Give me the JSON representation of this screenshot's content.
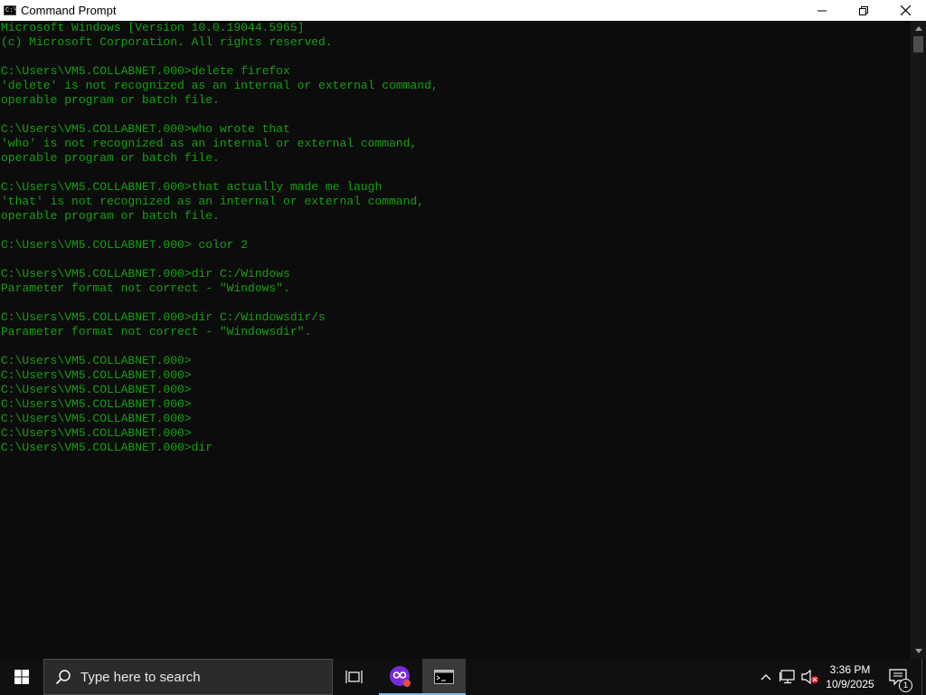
{
  "window": {
    "title": "Command Prompt",
    "icon": "cmd-icon",
    "controls": [
      "minimize-icon",
      "restore-icon",
      "close-icon"
    ]
  },
  "terminal": {
    "text_color": "#13a10e",
    "background": "#0c0c0c",
    "lines": [
      "Microsoft Windows [Version 10.0.19044.5965]",
      "(c) Microsoft Corporation. All rights reserved.",
      "",
      "C:\\Users\\VM5.COLLABNET.000>delete firefox",
      "'delete' is not recognized as an internal or external command,",
      "operable program or batch file.",
      "",
      "C:\\Users\\VM5.COLLABNET.000>who wrote that",
      "'who' is not recognized as an internal or external command,",
      "operable program or batch file.",
      "",
      "C:\\Users\\VM5.COLLABNET.000>that actually made me laugh",
      "'that' is not recognized as an internal or external command,",
      "operable program or batch file.",
      "",
      "C:\\Users\\VM5.COLLABNET.000> color 2",
      "",
      "C:\\Users\\VM5.COLLABNET.000>dir C:/Windows",
      "Parameter format not correct - \"Windows\".",
      "",
      "C:\\Users\\VM5.COLLABNET.000>dir C:/Windowsdir/s",
      "Parameter format not correct - \"Windowsdir\".",
      "",
      "C:\\Users\\VM5.COLLABNET.000>",
      "C:\\Users\\VM5.COLLABNET.000>",
      "C:\\Users\\VM5.COLLABNET.000>",
      "C:\\Users\\VM5.COLLABNET.000>",
      "C:\\Users\\VM5.COLLABNET.000>",
      "C:\\Users\\VM5.COLLABNET.000>",
      "C:\\Users\\VM5.COLLABNET.000>dir"
    ]
  },
  "taskbar": {
    "search_placeholder": "Type here to search",
    "apps": [
      "task-view-icon",
      "app-icon",
      "cmd-icon"
    ],
    "tray_icons": [
      "chevron-up-icon",
      "network-icon",
      "volume-muted-icon"
    ],
    "time": "3:36 PM",
    "date": "10/9/2025",
    "notification_count": "1",
    "accent_color": "#76b9ed"
  }
}
